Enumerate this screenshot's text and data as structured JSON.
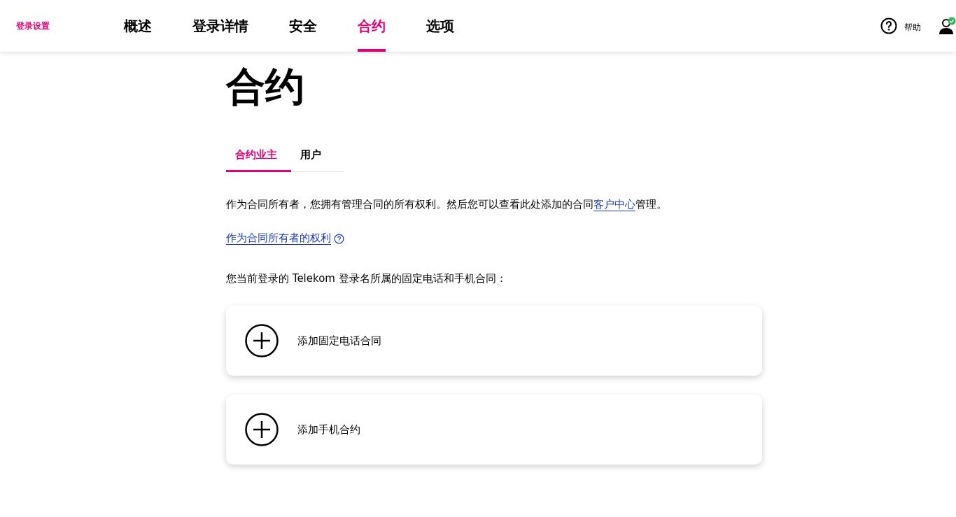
{
  "header": {
    "brand": "登录设置",
    "nav_tabs": [
      {
        "label": "概述",
        "selected": false
      },
      {
        "label": "登录详情",
        "selected": false
      },
      {
        "label": "安全",
        "selected": false
      },
      {
        "label": "合约",
        "selected": true
      },
      {
        "label": "选项",
        "selected": false
      }
    ],
    "help_label": "帮助",
    "user_verified": true
  },
  "page_title": "合约",
  "sub_tabs": [
    {
      "label": "合约业主",
      "selected": true
    },
    {
      "label": "用户",
      "selected": false
    }
  ],
  "intro": {
    "text_before": "作为合同所有者，您拥有管理合同的所有权利。然后您可以查看此处添加的合同",
    "link": "客户中心",
    "text_after": "管理。"
  },
  "rights_link": "作为合同所有者的权利",
  "list_label": "您当前登录的 Telekom 登录名所属的固定电话和手机合同：",
  "cards": [
    {
      "label": "添加固定电话合同"
    },
    {
      "label": "添加手机合约"
    }
  ]
}
